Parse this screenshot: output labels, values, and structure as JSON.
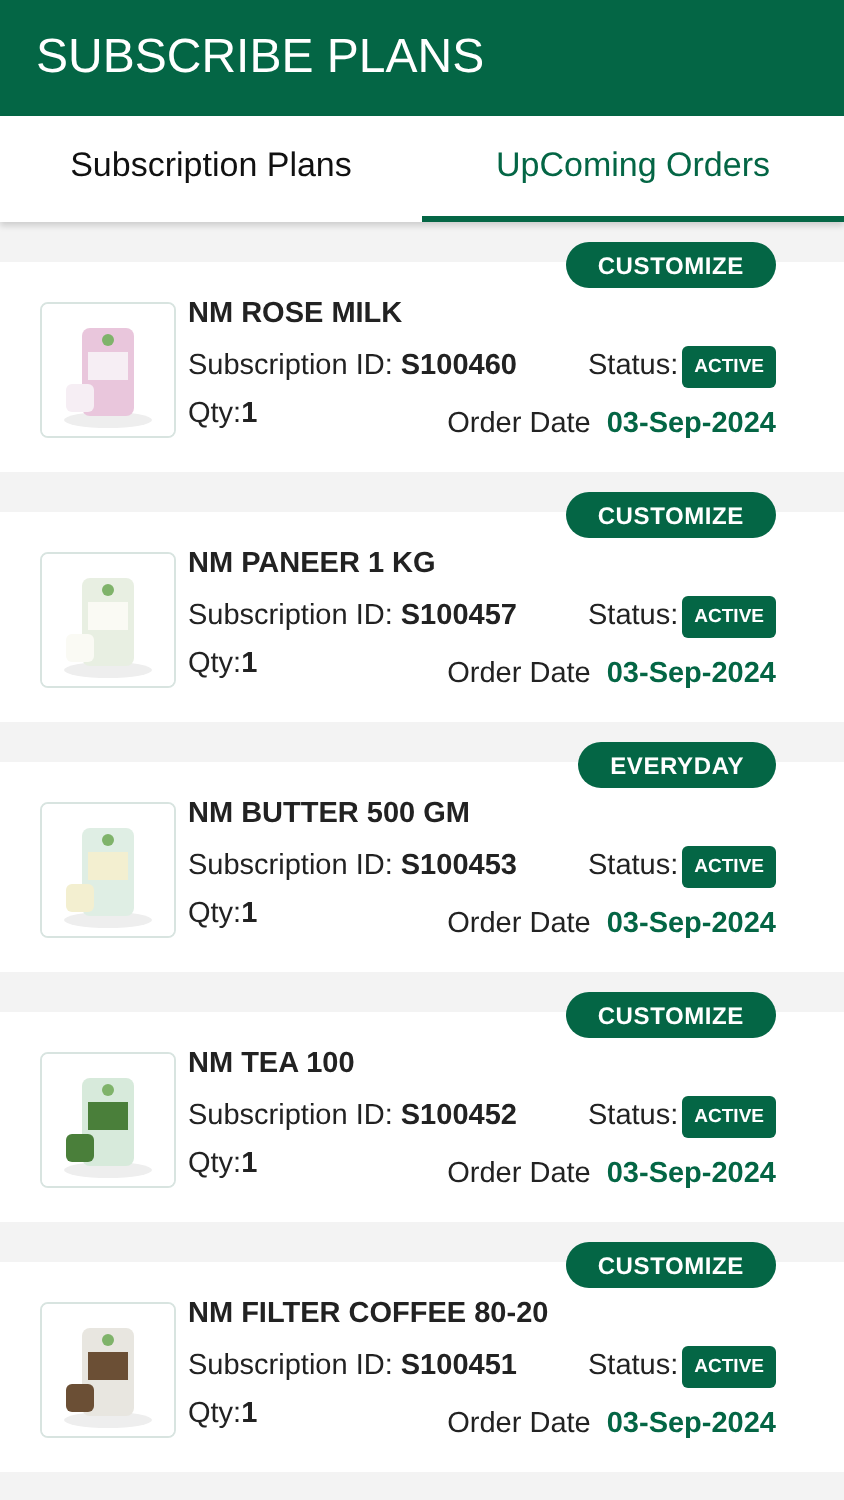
{
  "header": {
    "title": "SUBSCRIBE PLANS"
  },
  "tabs": [
    {
      "label": "Subscription Plans",
      "selected": false
    },
    {
      "label": "UpComing Orders",
      "selected": true
    }
  ],
  "orders": [
    {
      "kind": "order",
      "plan": "CUSTOMIZE",
      "name": "NM ROSE MILK",
      "subscription": "Subscription ID: **S100460**",
      "qty": "Qty:**1**",
      "status_label": "Status:",
      "status": "ACTIVE",
      "date_label": "Order Date",
      "date": "03-Sep-2024"
    },
    {
      "kind": "order",
      "plan": "CUSTOMIZE",
      "name": "NM PANEER 1 KG",
      "subscription": "Subscription ID: **S100457**",
      "qty": "Qty:**1**",
      "status_label": "Status:",
      "status": "ACTIVE",
      "date_label": "Order Date",
      "date": "03-Sep-2024"
    },
    {
      "kind": "order",
      "plan": "EVERYDAY",
      "name": "NM BUTTER 500 GM",
      "subscription": "Subscription ID: **S100453**",
      "qty": "Qty:**1**",
      "status_label": "Status:",
      "status": "ACTIVE",
      "date_label": "Order Date",
      "date": "03-Sep-2024"
    },
    {
      "kind": "order",
      "plan": "CUSTOMIZE",
      "name": "NM TEA 100",
      "subscription": "Subscription ID: **S100452**",
      "qty": "Qty:**1**",
      "status_label": "Status:",
      "status": "ACTIVE",
      "date_label": "Order Date",
      "date": "03-Sep-2024"
    },
    {
      "kind": "order",
      "plan": "CUSTOMIZE",
      "name": "NM FILTER COFFEE 80-20",
      "subscription": "Subscription ID: **S100451**",
      "qty": "Qty:**1**",
      "status_label": "Status:",
      "status": "ACTIVE",
      "date_label": "Order Date",
      "date": "03-Sep-2024"
    }
  ]
}
